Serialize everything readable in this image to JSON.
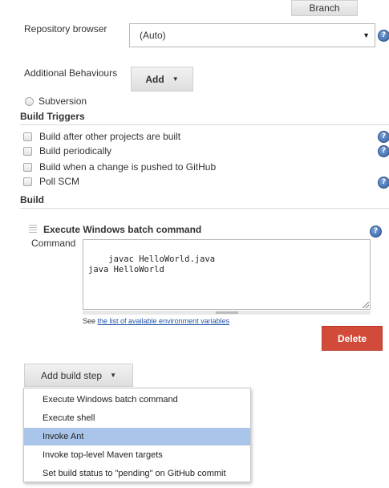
{
  "branch_button": {
    "label": "Branch"
  },
  "repository_browser": {
    "label": "Repository browser",
    "value": "(Auto)",
    "help": "?"
  },
  "additional_behaviours": {
    "label": "Additional Behaviours",
    "add_label": "Add"
  },
  "subversion": {
    "label": "Subversion"
  },
  "build_triggers": {
    "title": "Build Triggers",
    "items": [
      {
        "label": "Build after other projects are built",
        "help": "?"
      },
      {
        "label": "Build periodically",
        "help": "?"
      },
      {
        "label": "Build when a change is pushed to GitHub",
        "help": ""
      },
      {
        "label": "Poll SCM",
        "help": "?"
      }
    ]
  },
  "build": {
    "title": "Build",
    "step_title": "Execute Windows batch command",
    "help": "?",
    "command_label": "Command",
    "command_value": "javac HelloWorld.java\njava HelloWorld",
    "env_prefix": "See ",
    "env_link": "the list of available environment variables",
    "delete_label": "Delete"
  },
  "add_build_step": {
    "label": "Add build step",
    "menu_items": [
      "Execute Windows batch command",
      "Execute shell",
      "Invoke Ant",
      "Invoke top-level Maven targets",
      "Set build status to \"pending\" on GitHub commit"
    ],
    "highlighted_index": 2
  },
  "colors": {
    "delete": "#d24b3a",
    "menu_highlight": "#a9c6ea",
    "link": "#2255aa",
    "help_icon": "#2f5fa8"
  }
}
